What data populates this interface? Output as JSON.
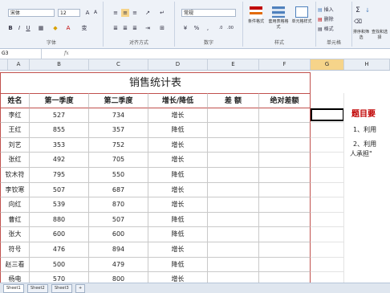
{
  "ribbon": {
    "font_name": "宋体",
    "font_size": "12",
    "number_format": "常规",
    "group_font": "字体",
    "group_align": "对齐方式",
    "group_number": "数字",
    "group_styles": "样式",
    "group_cells": "单元格",
    "insert": "插入",
    "delete": "删除",
    "format": "格式",
    "cond_format": "条件格式",
    "table_format": "套用表格格式",
    "cell_style": "单元格样式",
    "sort_filter": "排序和筛选",
    "find_select": "查找和选择"
  },
  "formula_bar": {
    "name_box": "G3",
    "fx": "fx"
  },
  "columns": [
    "A",
    "B",
    "C",
    "D",
    "E",
    "F",
    "G",
    "H"
  ],
  "table": {
    "title": "销售统计表",
    "headers": [
      "姓名",
      "第一季度",
      "第二季度",
      "增长/降低",
      "差 额",
      "绝对差额"
    ],
    "rows": [
      [
        "李红",
        "527",
        "734",
        "增长"
      ],
      [
        "王红",
        "855",
        "357",
        "降低"
      ],
      [
        "刘艺",
        "353",
        "752",
        "增长"
      ],
      [
        "张红",
        "492",
        "705",
        "增长"
      ],
      [
        "钦木符",
        "795",
        "550",
        "降低"
      ],
      [
        "李钦寒",
        "507",
        "687",
        "增长"
      ],
      [
        "向红",
        "539",
        "870",
        "增长"
      ],
      [
        "曹红",
        "880",
        "507",
        "降低"
      ],
      [
        "张大",
        "600",
        "600",
        "降低"
      ],
      [
        "符号",
        "476",
        "894",
        "增长"
      ],
      [
        "赵三看",
        "500",
        "479",
        "降低"
      ],
      [
        "杨电",
        "570",
        "800",
        "增长"
      ]
    ]
  },
  "side": {
    "title": "题目要",
    "line1": "1、利用",
    "line2": "2、利用",
    "line3": "人承担\""
  },
  "sheets": [
    "Sheet1",
    "Sheet2",
    "Sheet3"
  ],
  "colors": {
    "title_border": "#c0504d",
    "side_title": "#c00000",
    "selected_col": "#f6d48a"
  }
}
